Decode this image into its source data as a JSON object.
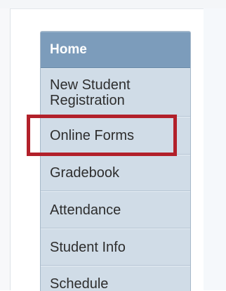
{
  "nav": {
    "items": [
      {
        "label": "Home"
      },
      {
        "label_line1": "New Student",
        "label_line2": "Registration"
      },
      {
        "label": "Online Forms"
      },
      {
        "label": "Gradebook"
      },
      {
        "label": "Attendance"
      },
      {
        "label": "Student Info"
      },
      {
        "label": "Schedule"
      }
    ]
  },
  "colors": {
    "active_item_bg": "#7c9cbb",
    "item_bg": "#d0dce7",
    "highlight_border": "#b2202a"
  }
}
